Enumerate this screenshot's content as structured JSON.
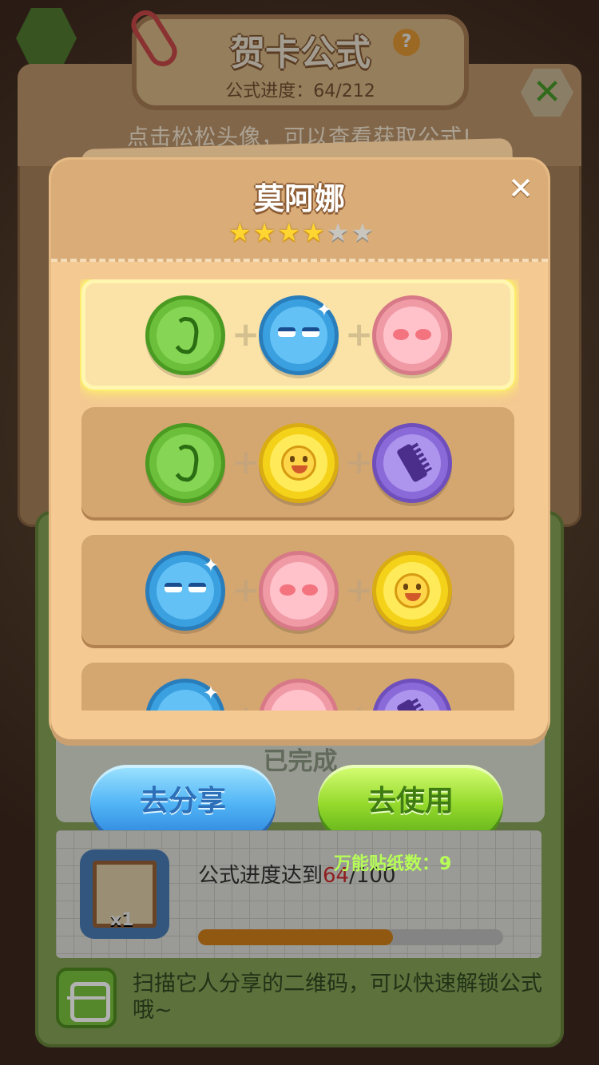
{
  "background": {
    "title": "贺卡公式",
    "progress_label": "公式进度：",
    "progress_value": "64/212",
    "hint": "点击松松头像，可以查看获取公式!",
    "completed_label": "已完成",
    "mission_text_prefix": "公式进度达到",
    "mission_current": "64",
    "mission_target": "/100",
    "mission_progress": 0.64,
    "reward_count": "x1",
    "scan_hint": "扫描它人分享的二维码，可以快速解锁公式哦~"
  },
  "modal": {
    "title": "莫阿娜",
    "stars_total": 6,
    "stars_filled": 4,
    "star_glyph": "★",
    "close_glyph": "✕",
    "plus_glyph": "+",
    "formulas": [
      [
        "ear-icon",
        "sleepy-face-icon",
        "blush-face-icon"
      ],
      [
        "ear-icon",
        "smile-face-icon",
        "comb-icon"
      ],
      [
        "sleepy-face-icon",
        "blush-face-icon",
        "smile-face-icon"
      ],
      [
        "sleepy-face-icon",
        "blush-face-icon",
        "comb-icon"
      ]
    ],
    "selected_index": 0
  },
  "actions": {
    "share_label": "去分享",
    "use_label": "去使用",
    "wildcard_label": "万能贴纸数：",
    "wildcard_count": "9"
  },
  "colors": {
    "modal_bg": "#f4c992",
    "card_bg": "#d5a770",
    "selected_card_bg": "#fbe3a8",
    "share_button": "#4fb3f5",
    "use_button": "#93d82b",
    "star_on": "#ffd531",
    "star_off": "#c9c6c0"
  }
}
